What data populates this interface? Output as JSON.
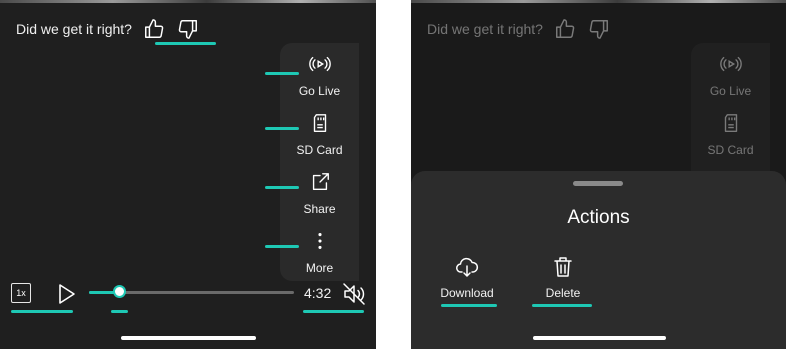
{
  "colors": {
    "accent": "#1ec8b4",
    "background": "#1f1f1f",
    "sheet": "#2c2c2c"
  },
  "feedback": {
    "question": "Did we get it right?",
    "thumbs_up_icon": "thumbs-up-icon",
    "thumbs_down_icon": "thumbs-down-icon"
  },
  "side_menu": {
    "items": [
      {
        "label": "Go Live",
        "icon": "broadcast-icon"
      },
      {
        "label": "SD Card",
        "icon": "sd-card-icon"
      },
      {
        "label": "Share",
        "icon": "share-icon"
      },
      {
        "label": "More",
        "icon": "more-vertical-icon"
      }
    ]
  },
  "player": {
    "speed": "1x",
    "time": "4:32",
    "progress": 0.15,
    "play_icon": "play-icon",
    "mute_icon": "volume-muted-icon"
  },
  "actions_sheet": {
    "title": "Actions",
    "items": [
      {
        "label": "Download",
        "icon": "cloud-download-icon"
      },
      {
        "label": "Delete",
        "icon": "trash-icon"
      }
    ]
  }
}
